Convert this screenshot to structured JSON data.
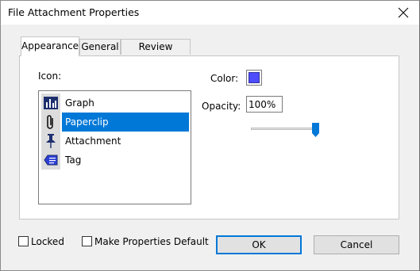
{
  "window": {
    "title": "File Attachment Properties"
  },
  "tabs": [
    {
      "label": "Appearance"
    },
    {
      "label": "General"
    },
    {
      "label": "Review History"
    }
  ],
  "appearance": {
    "icon_label": "Icon:",
    "icons": [
      {
        "label": "Graph",
        "icon": "graph-icon"
      },
      {
        "label": "Paperclip",
        "icon": "paperclip-icon",
        "selected": true
      },
      {
        "label": "Attachment",
        "icon": "pushpin-icon"
      },
      {
        "label": "Tag",
        "icon": "tag-icon"
      }
    ],
    "color_label": "Color:",
    "color_value": "#4d4dff",
    "opacity_label": "Opacity:",
    "opacity_value": "100%",
    "opacity_slider": 1.0
  },
  "footer": {
    "locked_label": "Locked",
    "locked_checked": false,
    "make_default_label": "Make Properties Default",
    "make_default_checked": false,
    "ok_label": "OK",
    "cancel_label": "Cancel"
  }
}
